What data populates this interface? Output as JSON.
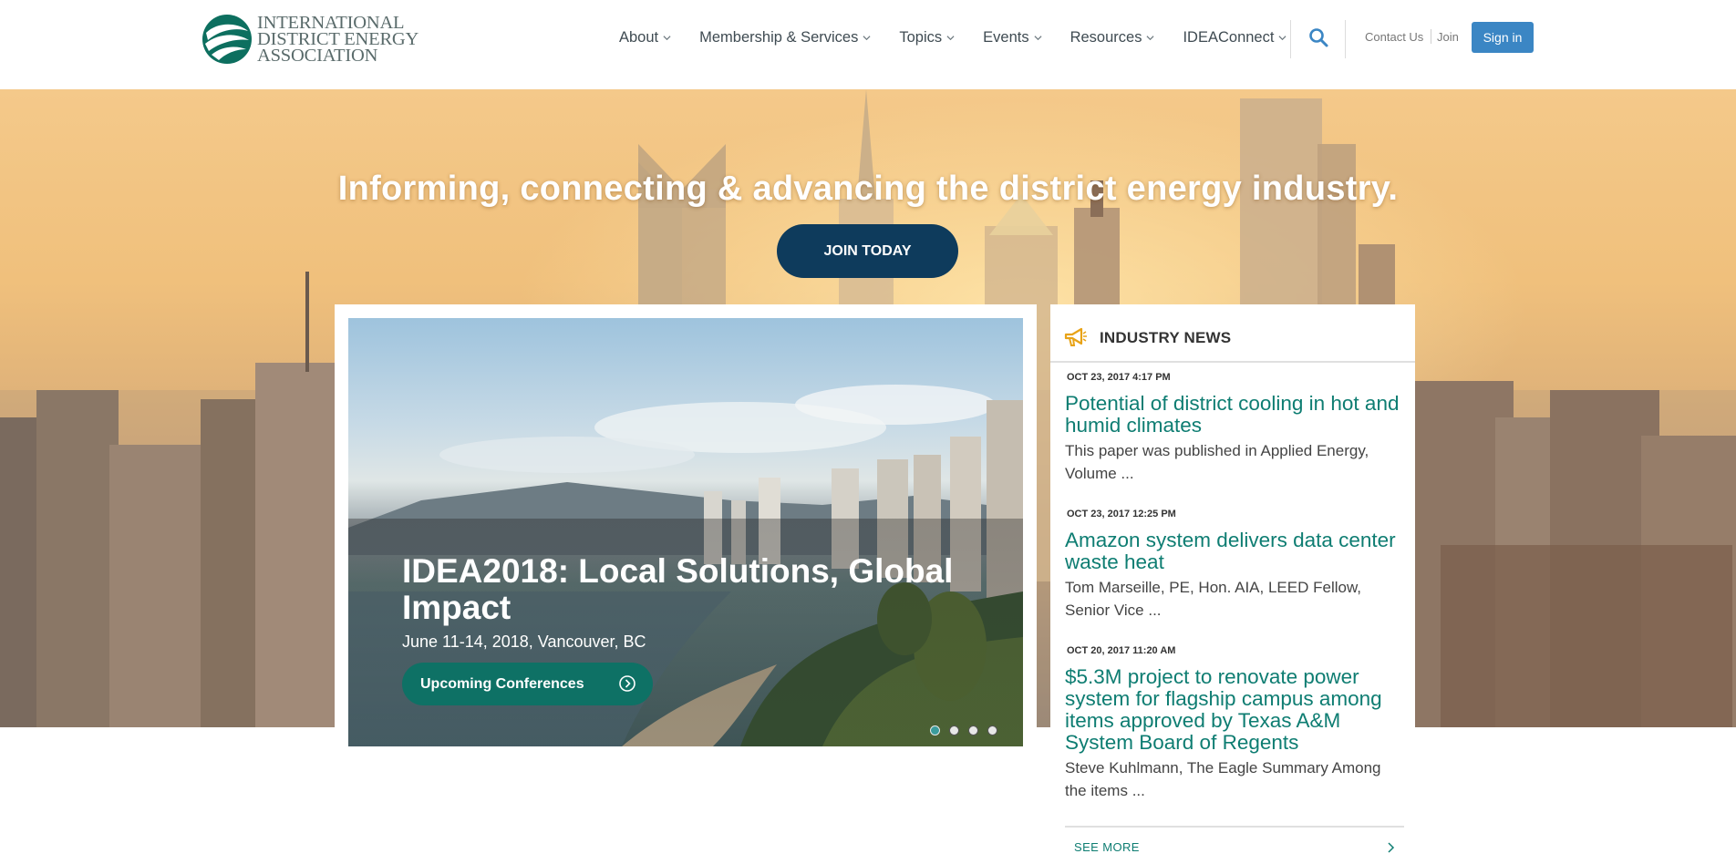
{
  "header": {
    "logo_lines": [
      "INTERNATIONAL",
      "DISTRICT ENERGY",
      "ASSOCIATION"
    ],
    "nav": [
      "About",
      "Membership & Services",
      "Topics",
      "Events",
      "Resources",
      "IDEAConnect"
    ],
    "contact": "Contact Us",
    "join": "Join",
    "signin": "Sign in"
  },
  "hero": {
    "tagline": "Informing, connecting & advancing the district energy industry.",
    "join_button": "JOIN TODAY"
  },
  "carousel": {
    "title": "IDEA2018: Local Solutions, Global Impact",
    "subtitle": "June 11-14, 2018, Vancouver, BC",
    "button": "Upcoming Conferences",
    "slide_count": 4,
    "active_slide": 1
  },
  "news": {
    "heading": "INDUSTRY NEWS",
    "items": [
      {
        "date": "OCT 23, 2017 4:17 PM",
        "title": "Potential of district cooling in hot and humid climates",
        "excerpt": "This paper was published in  Applied Energy, Volume ..."
      },
      {
        "date": "OCT 23, 2017 12:25 PM",
        "title": "Amazon system delivers data center waste heat",
        "excerpt": "Tom Marseille, PE, Hon. AIA, LEED Fellow, Senior Vice ..."
      },
      {
        "date": "OCT 20, 2017 11:20 AM",
        "title": "$5.3M project to renovate power system for flagship campus among items approved by Texas A&M System Board of Regents",
        "excerpt": "Steve Kuhlmann, The Eagle Summary Among the items ..."
      }
    ],
    "see_more": "SEE MORE"
  },
  "colors": {
    "brand_teal": "#0e7d72",
    "navy_button": "#0e3b5c",
    "signin_blue": "#3b86c4",
    "megaphone_gold": "#e8a317"
  },
  "icons": [
    "logo-swirl-icon",
    "chevron-down-icon",
    "search-icon",
    "megaphone-icon",
    "arrow-circle-right-icon",
    "chevron-right-icon"
  ]
}
